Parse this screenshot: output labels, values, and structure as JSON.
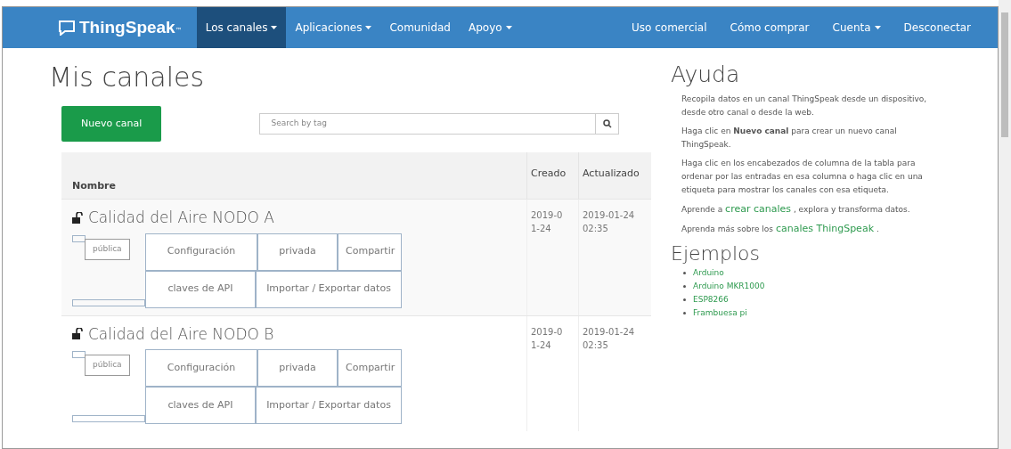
{
  "navbar": {
    "brand": "ThingSpeak",
    "trademark": "™",
    "left_items": [
      {
        "label": "Los canales",
        "dropdown": true,
        "selected": true
      },
      {
        "label": "Aplicaciones",
        "dropdown": true,
        "selected": false
      },
      {
        "label": "Comunidad",
        "dropdown": false,
        "selected": false
      },
      {
        "label": "Apoyo",
        "dropdown": true,
        "selected": false
      }
    ],
    "right_items": [
      {
        "label": "Uso comercial",
        "dropdown": false,
        "selected": false
      },
      {
        "label": "Cómo comprar",
        "dropdown": false,
        "selected": false
      },
      {
        "label": "Cuenta",
        "dropdown": true,
        "selected": false
      },
      {
        "label": "Desconectar",
        "dropdown": false,
        "selected": false
      }
    ]
  },
  "main": {
    "title": "Mis canales",
    "new_button": "Nuevo canal",
    "search": {
      "placeholder": "Search by tag"
    },
    "table": {
      "columns": [
        "Nombre",
        "Creado",
        "Actualizado"
      ],
      "rows": [
        {
          "name": "Calidad del Aire NODO A",
          "created": "2019-0\n1-24",
          "updated": "2019-01-24\n02:35",
          "tag": "pública",
          "buttons_top": [
            "Configuración",
            "privada",
            "Compartir"
          ],
          "buttons_bottom": [
            "claves de API",
            "Importar / Exportar datos"
          ]
        },
        {
          "name": "Calidad del Aire NODO B",
          "created": "2019-0\n1-24",
          "updated": "2019-01-24\n02:35",
          "tag": "pública",
          "buttons_top": [
            "Configuración",
            "privada",
            "Compartir"
          ],
          "buttons_bottom": [
            "claves de API",
            "Importar / Exportar datos"
          ]
        }
      ]
    }
  },
  "help": {
    "title": "Ayuda",
    "paragraphs": [
      [
        {
          "text": "Recopila datos en un canal ThingSpeak desde un dispositivo, desde otro canal o desde la web."
        }
      ],
      [
        {
          "text": "Haga clic en **Nuevo canal** para crear un nuevo canal ThingSpeak."
        }
      ],
      [
        {
          "text": "Haga clic en los encabezados de columna de la tabla para ordenar por las entradas en esa columna o haga clic en una etiqueta para mostrar los canales con esa etiqueta."
        }
      ],
      [
        {
          "text": "Aprende a "
        },
        {
          "text": "crear canales",
          "link": true
        },
        {
          "text": " , explora y transforma datos."
        }
      ],
      [
        {
          "text": "Aprenda más sobre los "
        },
        {
          "text": "canales ThingSpeak",
          "link": true
        },
        {
          "text": " ."
        }
      ]
    ],
    "examples_title": "Ejemplos",
    "examples": [
      "Arduino",
      "Arduino MKR1000",
      "ESP8266",
      "Frambuesa pi"
    ]
  }
}
